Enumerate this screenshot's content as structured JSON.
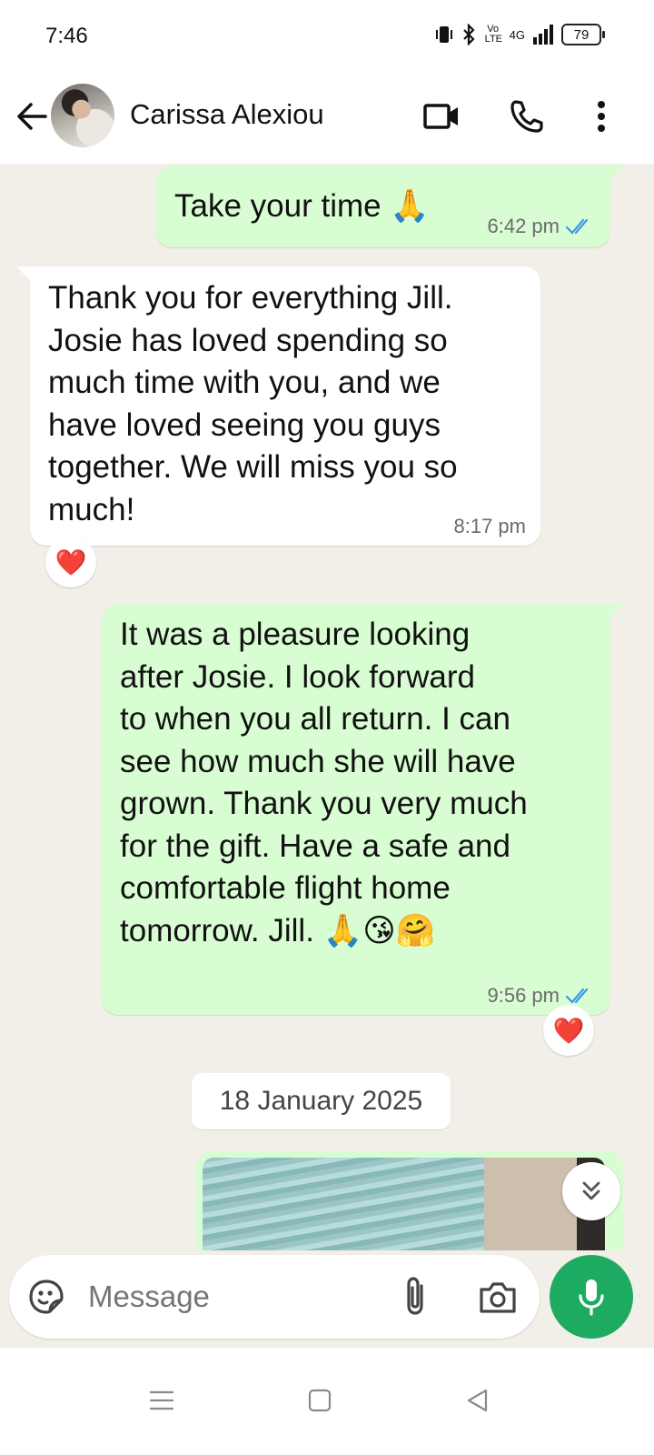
{
  "status_bar": {
    "time": "7:46",
    "network": "4G",
    "volte": "Vo LTE",
    "battery": "79"
  },
  "header": {
    "contact_name": "Carissa Alexiou",
    "icons": [
      "back-arrow-icon",
      "video-call-icon",
      "phone-icon",
      "more-options-icon"
    ]
  },
  "messages": [
    {
      "direction": "out",
      "text": "Take your time 🙏",
      "time": "6:42 pm",
      "status": "read"
    },
    {
      "direction": "in",
      "text": "Thank you for everything Jill.\nJosie has loved spending so\nmuch time with you, and we\nhave loved seeing you guys\ntogether. We will miss you so\nmuch!",
      "time": "8:17 pm",
      "reaction": "❤️"
    },
    {
      "direction": "out",
      "text": "It was a pleasure looking\nafter Josie. I look forward\nto when you all return. I can\nsee how much she will have\ngrown. Thank you very much\nfor the gift. Have a safe and\ncomfortable flight home\ntomorrow. Jill. 🙏😘🤗",
      "time": "9:56 pm",
      "status": "read",
      "reaction": "❤️"
    }
  ],
  "date_separator": "18 January 2025",
  "composer": {
    "placeholder": "Message"
  },
  "colors": {
    "chat_background": "#f2efe9",
    "outgoing_bubble": "#d9fdd3",
    "incoming_bubble": "#ffffff",
    "read_ticks": "#3a9be5",
    "mic_button": "#1daa61"
  }
}
